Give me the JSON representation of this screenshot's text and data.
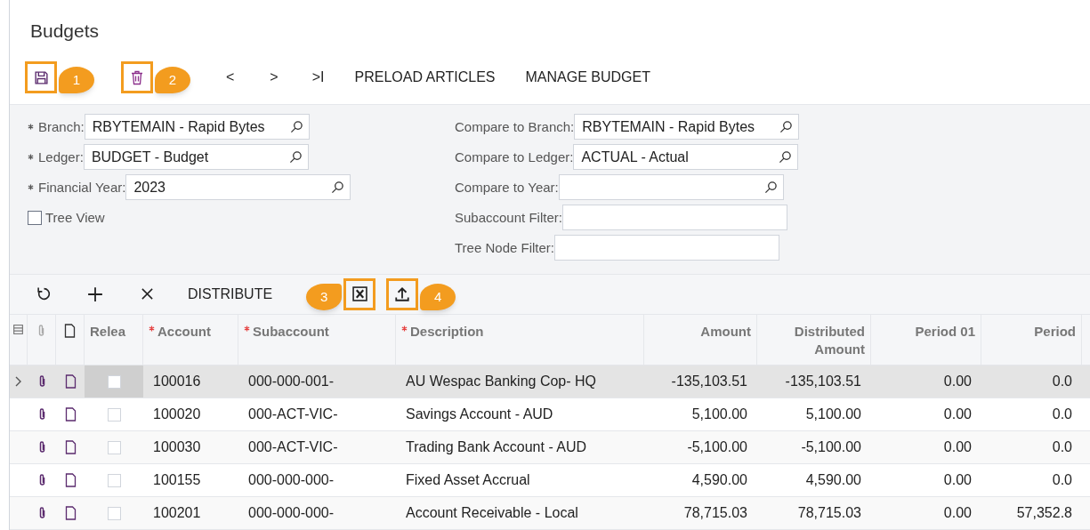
{
  "title": "Budgets",
  "toolbar": [
    {
      "kind": "save",
      "callout": "1"
    },
    {
      "kind": "delete",
      "callout": "2"
    },
    {
      "kind": "text",
      "label": "<"
    },
    {
      "kind": "text",
      "label": ">"
    },
    {
      "kind": "text",
      "label": ">I"
    },
    {
      "kind": "text",
      "label": "PRELOAD ARTICLES"
    },
    {
      "kind": "text",
      "label": "MANAGE BUDGET"
    }
  ],
  "form_left": [
    {
      "label": "Branch:",
      "required": true,
      "kind": "lookup",
      "value": "RBYTEMAIN - Rapid Bytes"
    },
    {
      "label": "Ledger:",
      "required": true,
      "kind": "lookup",
      "value": "BUDGET - Budget"
    },
    {
      "label": "Financial Year:",
      "required": true,
      "kind": "lookup",
      "value": "2023"
    },
    {
      "label": "Tree View",
      "kind": "checkbox",
      "checked": false
    }
  ],
  "form_right": [
    {
      "label": "Compare to Branch:",
      "kind": "lookup",
      "value": "RBYTEMAIN - Rapid Bytes"
    },
    {
      "label": "Compare to Ledger:",
      "kind": "lookup",
      "value": "ACTUAL - Actual"
    },
    {
      "label": "Compare to Year:",
      "kind": "lookup"
    },
    {
      "label": "Subaccount Filter:",
      "kind": "text"
    },
    {
      "label": "Tree Node Filter:",
      "kind": "text"
    }
  ],
  "grid_toolbar": [
    {
      "kind": "refresh"
    },
    {
      "kind": "add"
    },
    {
      "kind": "remove"
    },
    {
      "kind": "text",
      "label": "DISTRIBUTE"
    },
    {
      "kind": "excel",
      "callout": "3"
    },
    {
      "kind": "upload",
      "callout": "4"
    }
  ],
  "table": {
    "release_header": "Relea",
    "columns": [
      {
        "label": "Account",
        "required": true,
        "numeric": false
      },
      {
        "label": "Subaccount",
        "required": true,
        "numeric": false
      },
      {
        "label": "Description",
        "required": true,
        "numeric": false
      },
      {
        "label": "Amount",
        "numeric": true
      },
      {
        "label": "Distributed Amount",
        "numeric": true
      },
      {
        "label": "Period 01",
        "numeric": true
      },
      {
        "label": "Period",
        "numeric": true
      }
    ],
    "rows": [
      {
        "selected": true,
        "released": false,
        "cells": [
          "100016",
          "000-000-001-",
          "AU Wespac Banking Cop- HQ",
          "-135,103.51",
          "-135,103.51",
          "0.00",
          "0.0"
        ]
      },
      {
        "selected": false,
        "released": false,
        "cells": [
          "100020",
          "000-ACT-VIC-",
          "Savings Account - AUD",
          "5,100.00",
          "5,100.00",
          "0.00",
          "0.0"
        ]
      },
      {
        "selected": false,
        "released": false,
        "cells": [
          "100030",
          "000-ACT-VIC-",
          "Trading Bank Account - AUD",
          "-5,100.00",
          "-5,100.00",
          "0.00",
          "0.0"
        ]
      },
      {
        "selected": false,
        "released": false,
        "cells": [
          "100155",
          "000-000-000-",
          "Fixed Asset Accrual",
          "4,590.00",
          "4,590.00",
          "0.00",
          "0.0"
        ]
      },
      {
        "selected": false,
        "released": false,
        "cells": [
          "100201",
          "000-000-000-",
          "Account Receivable - Local",
          "78,715.03",
          "78,715.03",
          "0.00",
          "57,352.8"
        ]
      }
    ]
  }
}
